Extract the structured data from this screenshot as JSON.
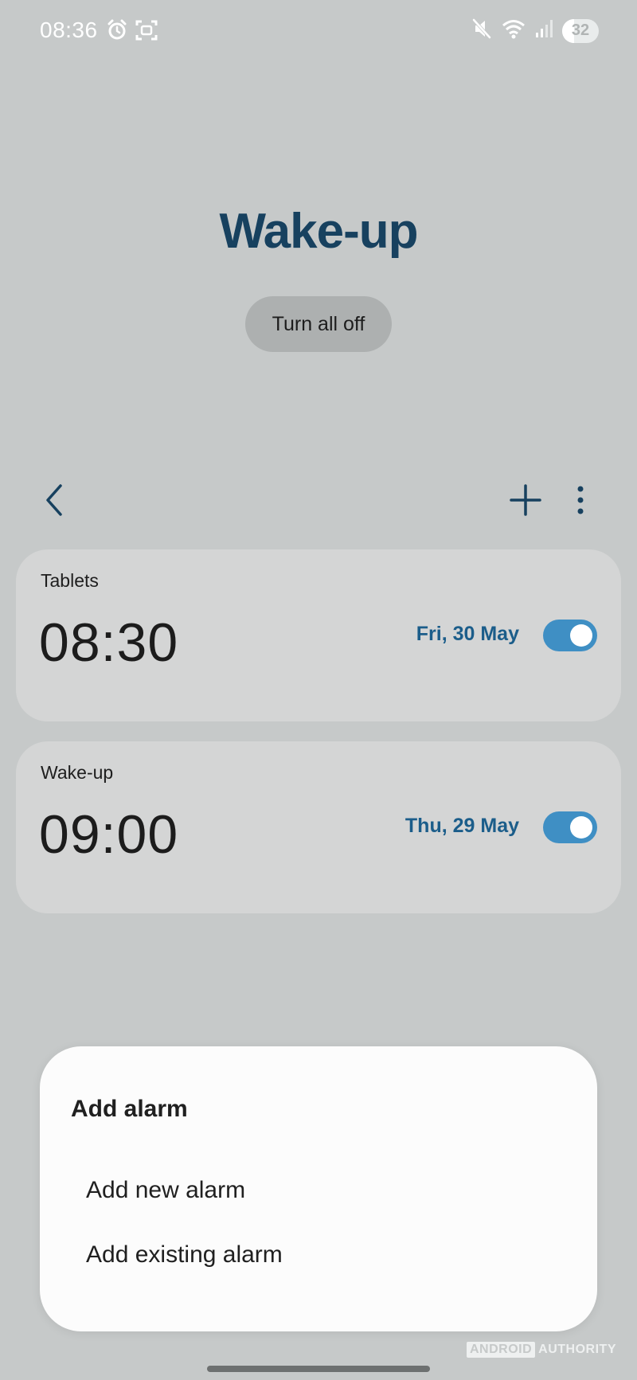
{
  "status_bar": {
    "time": "08:36",
    "left_icons": [
      "alarm-clock-icon",
      "screenshot-icon"
    ],
    "right_icons": [
      "mute-icon",
      "wifi-icon",
      "signal-icon"
    ],
    "battery_level": "32"
  },
  "header": {
    "title": "Wake-up",
    "turn_all_off_label": "Turn all off"
  },
  "toolbar": {
    "back_icon": "chevron-left-icon",
    "add_icon": "plus-icon",
    "more_icon": "more-vertical-icon"
  },
  "alarms": [
    {
      "label": "Tablets",
      "time": "08:30",
      "date": "Fri, 30 May",
      "enabled": true
    },
    {
      "label": "Wake-up",
      "time": "09:00",
      "date": "Thu, 29 May",
      "enabled": true
    }
  ],
  "dialog": {
    "title": "Add alarm",
    "options": [
      "Add new alarm",
      "Add existing alarm"
    ]
  },
  "watermark": {
    "part1": "ANDROID",
    "part2": "AUTHORITY"
  },
  "colors": {
    "background": "#c6c9c9",
    "title": "#17415f",
    "accent": "#3f8fc4",
    "date_text": "#1b5d8a",
    "card": "#d4d5d5",
    "dialog": "#fcfcfc"
  }
}
